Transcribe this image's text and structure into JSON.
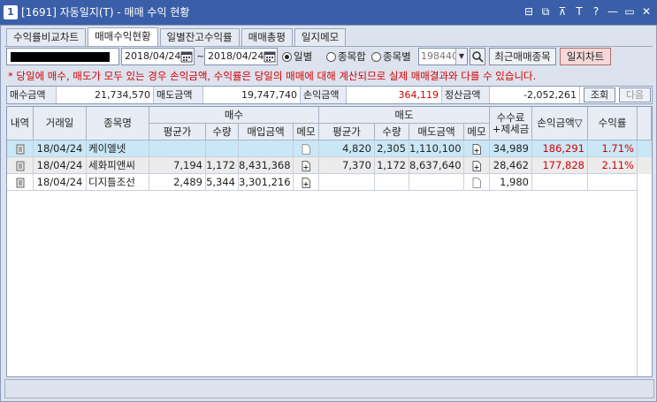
{
  "window": {
    "number": "1",
    "title": "[1691] 자동일지(T) - 매매 수익 현황",
    "icons": [
      "window-layout-icon",
      "copy-icon",
      "pin-icon",
      "font-icon",
      "help-icon",
      "minimize-icon",
      "restore-icon",
      "close-icon"
    ],
    "icon_glyphs": [
      "⊟",
      "⧉",
      "⊼",
      "T",
      "?",
      "—",
      "▭",
      "✕"
    ]
  },
  "tabs": [
    {
      "label": "수익률비교차트",
      "active": false
    },
    {
      "label": "매매수익현황",
      "active": true
    },
    {
      "label": "일별잔고수익률",
      "active": false
    },
    {
      "label": "매매총평",
      "active": false
    },
    {
      "label": "일지메모",
      "active": false
    }
  ],
  "controls": {
    "date_from": "2018/04/24",
    "tilde": "~",
    "date_to": "2018/04/24",
    "radios": [
      {
        "label": "일별",
        "checked": true
      },
      {
        "label": "종목합",
        "checked": false
      },
      {
        "label": "종목별",
        "checked": false
      }
    ],
    "stock_code": "198440",
    "recent_button": "최근매매종목",
    "journal_chart_button": "일지차트"
  },
  "notice": "* 당일에 매수, 매도가 모두 있는 경우 손익금액, 수익률은 당일의 매매에 대해 계산되므로 실제 매매결과와 다를 수 있습니다.",
  "summary": {
    "buy_label": "매수금액",
    "buy_value": "21,734,570",
    "sell_label": "매도금액",
    "sell_value": "19,747,740",
    "pnl_label": "손익금액",
    "pnl_value": "364,119",
    "settle_label": "정산금액",
    "settle_value": "-2,052,261",
    "query_button": "조회",
    "next_button": "다음"
  },
  "grid": {
    "headers": {
      "detail": "내역",
      "date": "거래일",
      "name": "종목명",
      "buy_group": "매수",
      "sell_group": "매도",
      "buy_avg": "평균가",
      "buy_qty": "수량",
      "buy_amount": "매입금액",
      "buy_memo": "메모",
      "sell_avg": "평균가",
      "sell_qty": "수량",
      "sell_amount": "매도금액",
      "sell_memo": "메모",
      "fee_line1": "수수료",
      "fee_line2": "+제세금",
      "pnl": "손익금액▽",
      "rate": "수익률"
    },
    "rows": [
      {
        "date": "18/04/24",
        "name": "케이엘넷",
        "buy_avg": "",
        "buy_qty": "",
        "buy_amount": "",
        "buy_memo": "empty",
        "sell_avg": "4,820",
        "sell_qty": "2,305",
        "sell_amount": "1,110,100",
        "sell_memo": "plus",
        "fee": "34,989",
        "pnl": "186,291",
        "rate": "1.71%",
        "selected": true
      },
      {
        "date": "18/04/24",
        "name": "세화피앤씨",
        "buy_avg": "7,194",
        "buy_qty": "1,172",
        "buy_amount": "8,431,368",
        "buy_memo": "plus",
        "sell_avg": "7,370",
        "sell_qty": "1,172",
        "sell_amount": "8,637,640",
        "sell_memo": "plus",
        "fee": "28,462",
        "pnl": "177,828",
        "rate": "2.11%",
        "selected": false
      },
      {
        "date": "18/04/24",
        "name": "디지틀조선",
        "buy_avg": "2,489",
        "buy_qty": "5,344",
        "buy_amount": "3,301,216",
        "buy_memo": "plus",
        "sell_avg": "",
        "sell_qty": "",
        "sell_amount": "",
        "sell_memo": "empty",
        "fee": "1,980",
        "pnl": "",
        "rate": "",
        "selected": false
      }
    ]
  },
  "colors": {
    "title_bar": "#3a5fa8",
    "profit": "#d40000",
    "selected_row": "#c9e7f6"
  }
}
